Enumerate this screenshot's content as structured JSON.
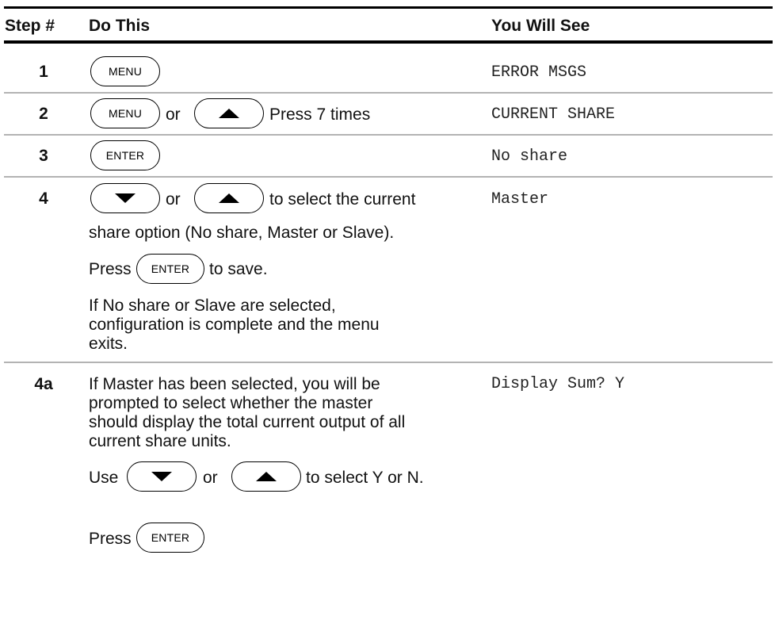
{
  "header": {
    "step_col": "Step #",
    "do_col": "Do This",
    "see_col": "You Will See"
  },
  "rows": [
    {
      "step": "1",
      "key1": "MENU",
      "see": "ERROR MSGS"
    },
    {
      "step": "2",
      "key1": "MENU",
      "or": "or",
      "key2_icon": "up-arrow-icon",
      "suffix": "Press 7 times",
      "see": "CURRENT SHARE"
    },
    {
      "step": "3",
      "key1": "ENTER",
      "see": "No share"
    },
    {
      "step": "4",
      "key1_icon": "down-arrow-icon",
      "or": "or",
      "key2_icon": "up-arrow-icon",
      "suffix": "to select the current",
      "line2": "share option (No share, Master or Slave).",
      "press_prefix": "Press",
      "press_key": "ENTER",
      "press_suffix": "to save.",
      "note": [
        "If No share or Slave are selected,",
        "configuration is complete and the menu",
        "exits."
      ],
      "see": "Master"
    },
    {
      "step": "4a",
      "text": [
        "If Master has been selected, you will be",
        "prompted to select whether the master",
        "should display the total current output of all",
        "current share units."
      ],
      "use_prefix": "Use",
      "or": "or",
      "use_suffix": "to select Y or N.",
      "press_prefix": "Press",
      "press_key": "ENTER",
      "see": "Display Sum? Y"
    }
  ]
}
